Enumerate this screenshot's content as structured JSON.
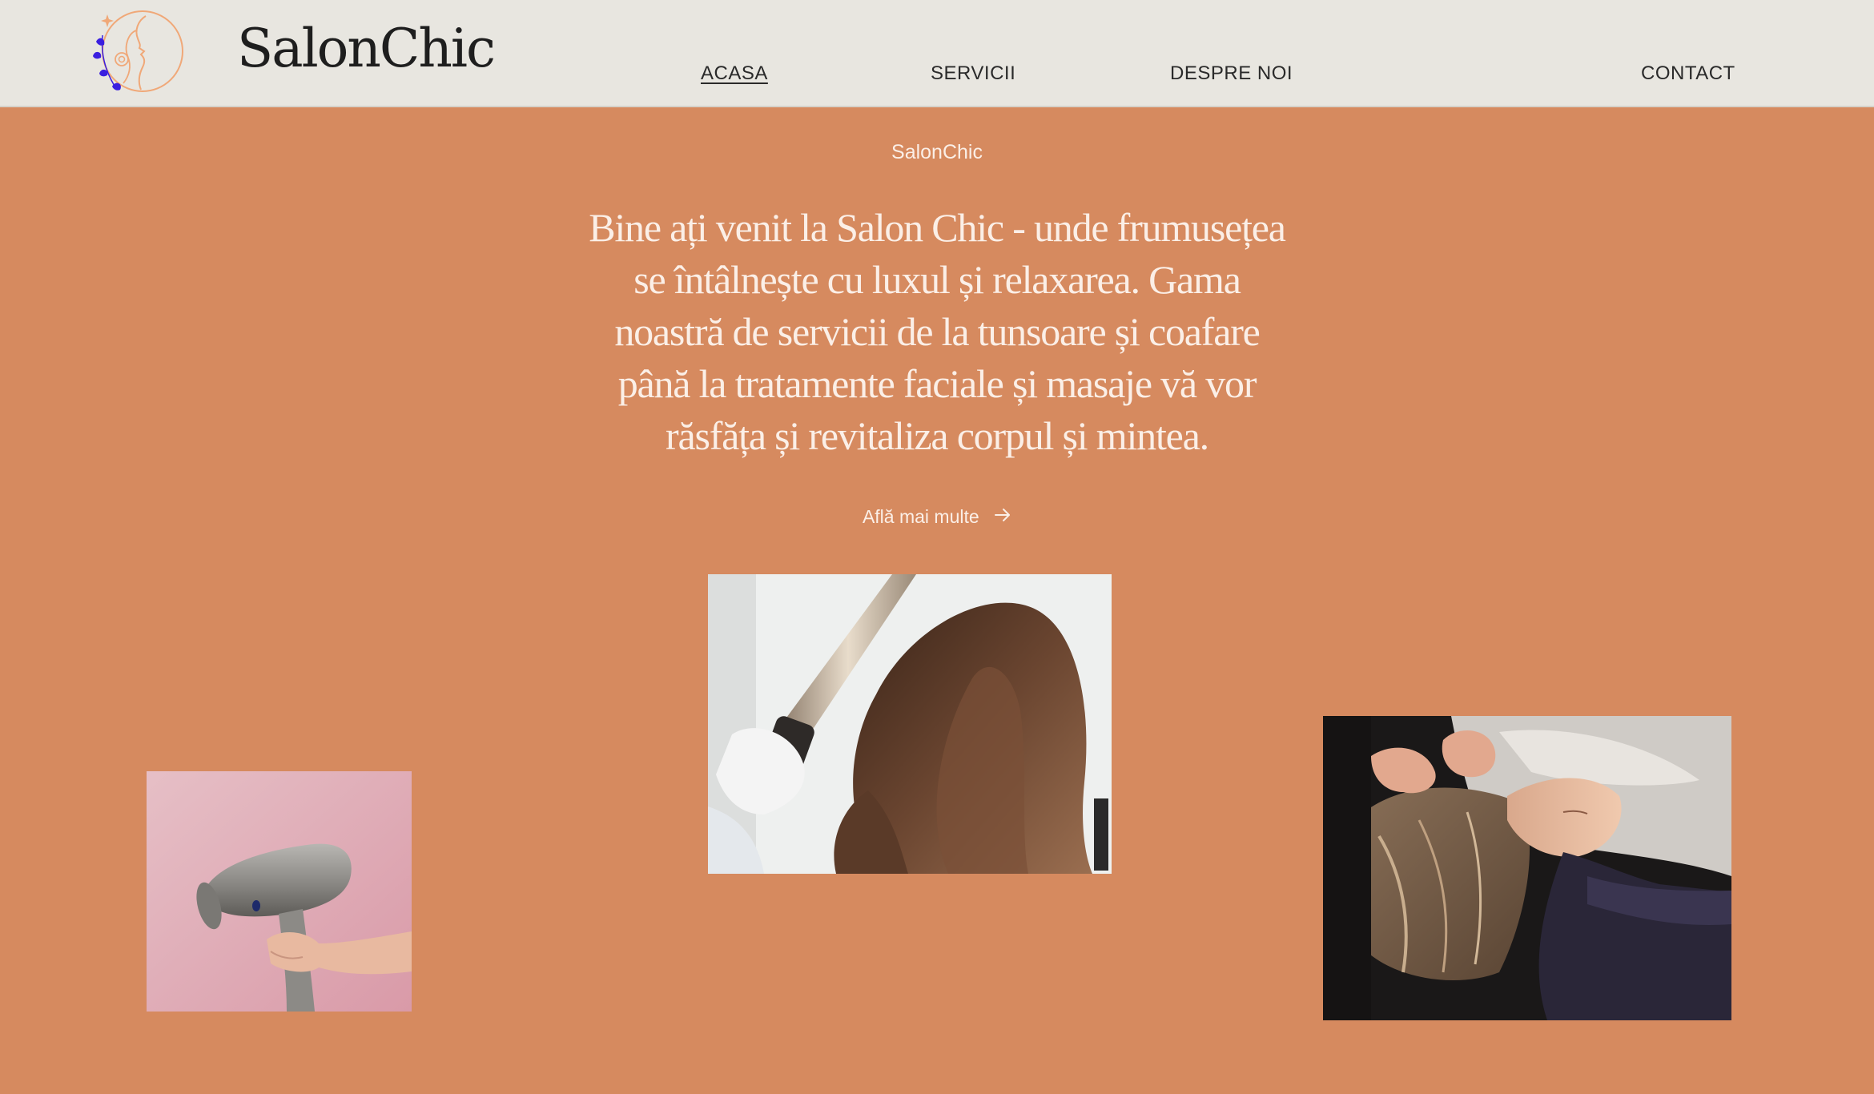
{
  "header": {
    "brand": "SalonChic",
    "logo_icon": "woman-profile-flower-icon",
    "nav": {
      "home": "ACASA",
      "services": "SERVICII",
      "about": "DESPRE NOI",
      "contact": "CONTACT"
    },
    "active_nav": "ACASA"
  },
  "hero": {
    "eyebrow": "SalonChic",
    "headline": "Bine ați venit la Salon Chic - unde frumusețea se întâlnește cu luxul și relaxarea. Gama noastră de servicii de la tunsoare și coafare până la tratamente faciale și masaje vă vor răsfăța și revitaliza corpul și mintea.",
    "cta_label": "Află mai multe",
    "cta_icon": "arrow-right-icon"
  },
  "colors": {
    "background": "#D68A5F",
    "header_bg": "#E8E6E0",
    "hero_text": "#FBEFE7",
    "nav_text": "#2A2A2A",
    "logo_accent": "#3A1FE0",
    "logo_line": "#F0A878"
  }
}
